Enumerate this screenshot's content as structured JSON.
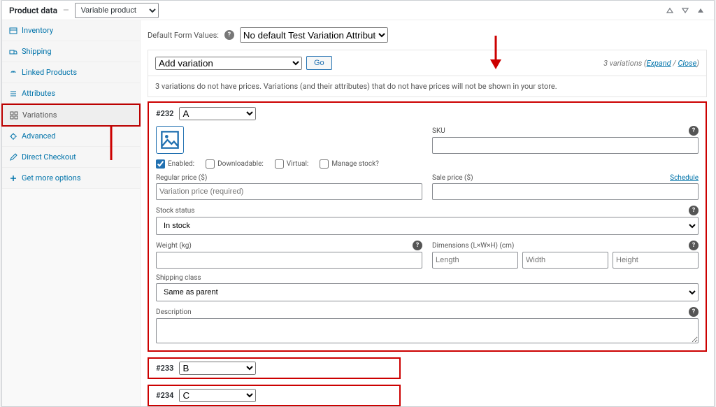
{
  "panel": {
    "title": "Product data",
    "type_value": "Variable product"
  },
  "sidebar": {
    "items": [
      {
        "icon": "inventory",
        "label": "Inventory"
      },
      {
        "icon": "shipping",
        "label": "Shipping"
      },
      {
        "icon": "linked",
        "label": "Linked Products"
      },
      {
        "icon": "attributes",
        "label": "Attributes"
      },
      {
        "icon": "variations",
        "label": "Variations"
      },
      {
        "icon": "advanced",
        "label": "Advanced"
      },
      {
        "icon": "checkout",
        "label": "Direct Checkout"
      },
      {
        "icon": "more",
        "label": "Get more options"
      }
    ]
  },
  "defaults": {
    "label": "Default Form Values:",
    "value": "No default Test Variation Attribute…"
  },
  "actionbar": {
    "select_value": "Add variation",
    "go": "Go",
    "count_text": "3 variations (",
    "expand": "Expand",
    "slash": " / ",
    "close": "Close",
    "paren": ")"
  },
  "notice": "3 variations do not have prices. Variations (and their attributes) that do not have prices will not be shown in your store.",
  "variation": {
    "id": "#232",
    "attr_value": "A",
    "sku_label": "SKU",
    "enabled_label": "Enabled:",
    "downloadable_label": "Downloadable:",
    "virtual_label": "Virtual:",
    "manage_stock_label": "Manage stock?",
    "regular_price_label": "Regular price ($)",
    "regular_price_placeholder": "Variation price (required)",
    "sale_price_label": "Sale price ($)",
    "schedule": "Schedule",
    "stock_status_label": "Stock status",
    "stock_status_value": "In stock",
    "weight_label": "Weight (kg)",
    "dimensions_label": "Dimensions (L×W×H) (cm)",
    "length_ph": "Length",
    "width_ph": "Width",
    "height_ph": "Height",
    "shipping_class_label": "Shipping class",
    "shipping_class_value": "Same as parent",
    "description_label": "Description"
  },
  "mini_rows": [
    {
      "id": "#233",
      "val": "B"
    },
    {
      "id": "#234",
      "val": "C"
    }
  ]
}
